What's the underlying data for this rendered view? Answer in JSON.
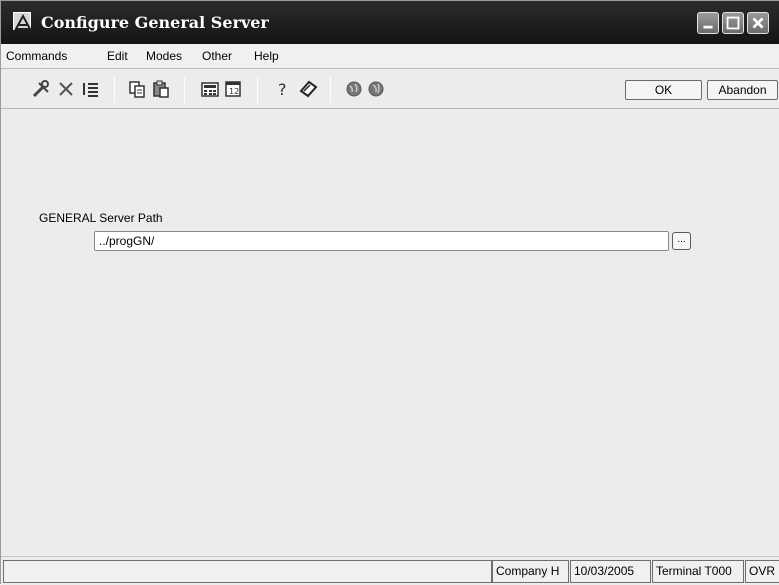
{
  "window": {
    "title": "Configure General Server"
  },
  "menu": [
    "Commands",
    "Edit",
    "Modes",
    "Other",
    "Help"
  ],
  "toolbar": {
    "icons": [
      "tools-icon",
      "close-x-icon",
      "list-icon",
      "copy-icon",
      "paste-icon",
      "calculator-icon",
      "calendar-icon",
      "help-icon",
      "book-icon",
      "globe-back-icon",
      "globe-forward-icon"
    ],
    "ok_label": "OK",
    "abandon_label": "Abandon"
  },
  "form": {
    "server_path_label": "GENERAL Server Path",
    "server_path_value": "../progGN/",
    "browse_label": "..."
  },
  "status": {
    "message": "",
    "company": "Company H",
    "date": "10/03/2005",
    "terminal": "Terminal T000",
    "mode": "OVR"
  }
}
